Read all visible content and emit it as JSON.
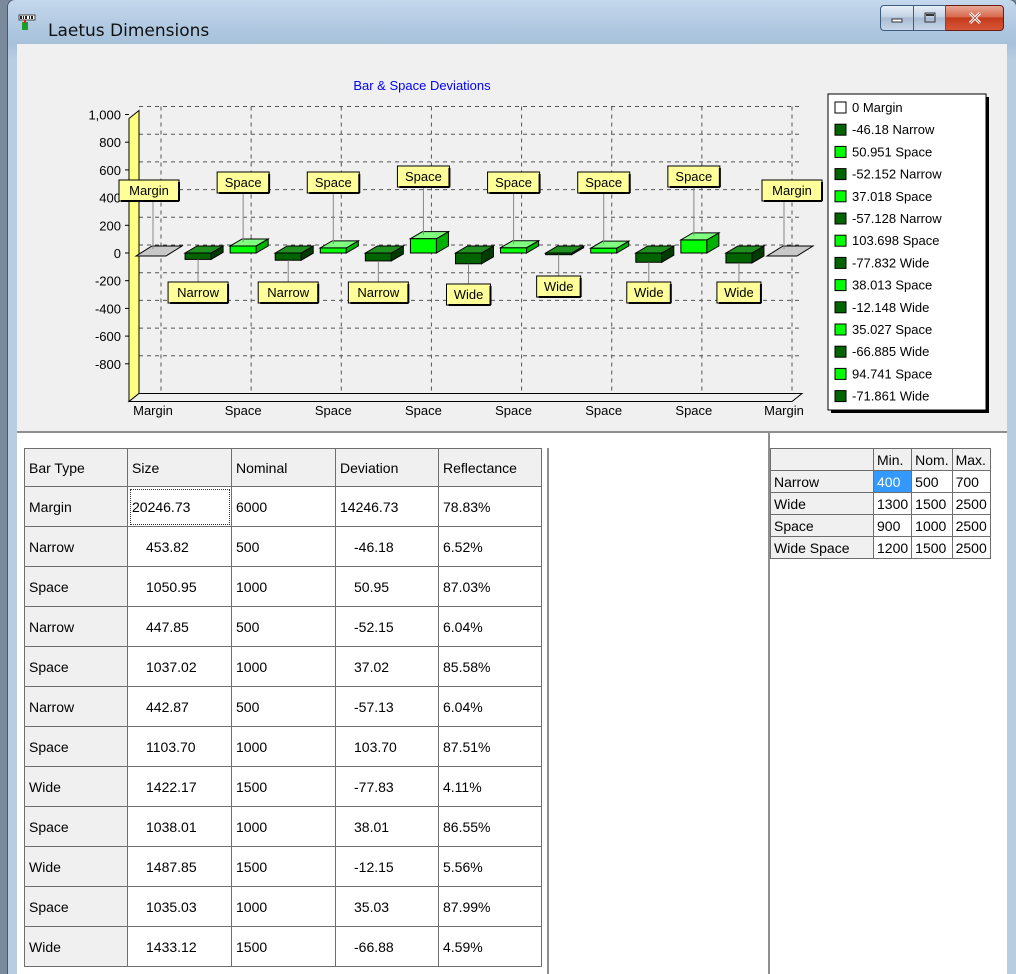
{
  "window": {
    "title": "Laetus Dimensions"
  },
  "chart_data": {
    "type": "bar",
    "title": "Bar & Space Deviations",
    "categories": [
      "Margin",
      "Narrow",
      "Space",
      "Narrow",
      "Space",
      "Narrow",
      "Space",
      "Wide",
      "Space",
      "Wide",
      "Space",
      "Wide",
      "Space",
      "Wide",
      "Margin"
    ],
    "values": [
      0,
      -46.18,
      50.951,
      -52.152,
      37.018,
      -57.128,
      103.698,
      -77.832,
      38.013,
      -12.148,
      35.027,
      -66.885,
      94.741,
      -71.861,
      0
    ],
    "ylim": [
      -1000,
      1000
    ],
    "y_ticks": [
      "1,000",
      "800",
      "600",
      "400",
      "200",
      "0",
      "-200",
      "-400",
      "-600",
      "-800"
    ],
    "x_tick_labels": [
      "Margin",
      "Space",
      "Space",
      "Space",
      "Space",
      "Space",
      "Space",
      "Margin"
    ],
    "bar_labels": [
      "Margin",
      "Narrow",
      "Space",
      "Narrow",
      "Space",
      "Narrow",
      "Space",
      "Wide",
      "Space",
      "Wide",
      "Space",
      "Wide",
      "Space",
      "Wide",
      "Margin"
    ],
    "legend": [
      "0 Margin",
      "-46.18 Narrow",
      "50.951 Space",
      "-52.152 Narrow",
      "37.018 Space",
      "-57.128 Narrow",
      "103.698 Space",
      "-77.832 Wide",
      "38.013 Space",
      "-12.148 Wide",
      "35.027 Space",
      "-66.885 Wide",
      "94.741 Space",
      "-71.861 Wide"
    ],
    "legend_placement": "right",
    "grid": true,
    "colors": {
      "Margin": "#c8c8c8",
      "Narrow": "#006400",
      "Space": "#00ff00",
      "Wide": "#006400",
      "label_bg": "#ffff99",
      "wall": "#ffff80",
      "title": "#0000ff"
    }
  },
  "bar_table": {
    "headers": [
      "Bar Type",
      "Size",
      "Nominal",
      "Deviation",
      "Reflectance"
    ],
    "rows": [
      [
        "Margin",
        "20246.73",
        "6000",
        "14246.73",
        "78.83%"
      ],
      [
        "Narrow",
        "453.82",
        "500",
        "-46.18",
        "6.52%"
      ],
      [
        "Space",
        "1050.95",
        "1000",
        "50.95",
        "87.03%"
      ],
      [
        "Narrow",
        "447.85",
        "500",
        "-52.15",
        "6.04%"
      ],
      [
        "Space",
        "1037.02",
        "1000",
        "37.02",
        "85.58%"
      ],
      [
        "Narrow",
        "442.87",
        "500",
        "-57.13",
        "6.04%"
      ],
      [
        "Space",
        "1103.70",
        "1000",
        "103.70",
        "87.51%"
      ],
      [
        "Wide",
        "1422.17",
        "1500",
        "-77.83",
        "4.11%"
      ],
      [
        "Space",
        "1038.01",
        "1000",
        "38.01",
        "86.55%"
      ],
      [
        "Wide",
        "1487.85",
        "1500",
        "-12.15",
        "5.56%"
      ],
      [
        "Space",
        "1035.03",
        "1000",
        "35.03",
        "87.99%"
      ],
      [
        "Wide",
        "1433.12",
        "1500",
        "-66.88",
        "4.59%"
      ]
    ]
  },
  "spec_table": {
    "headers": [
      "",
      "Min.",
      "Nom.",
      "Max."
    ],
    "rows": [
      [
        "Narrow",
        "400",
        "500",
        "700"
      ],
      [
        "Wide",
        "1300",
        "1500",
        "2500"
      ],
      [
        "Space",
        "900",
        "1000",
        "2500"
      ],
      [
        "Wide Space",
        "1200",
        "1500",
        "2500"
      ]
    ]
  }
}
